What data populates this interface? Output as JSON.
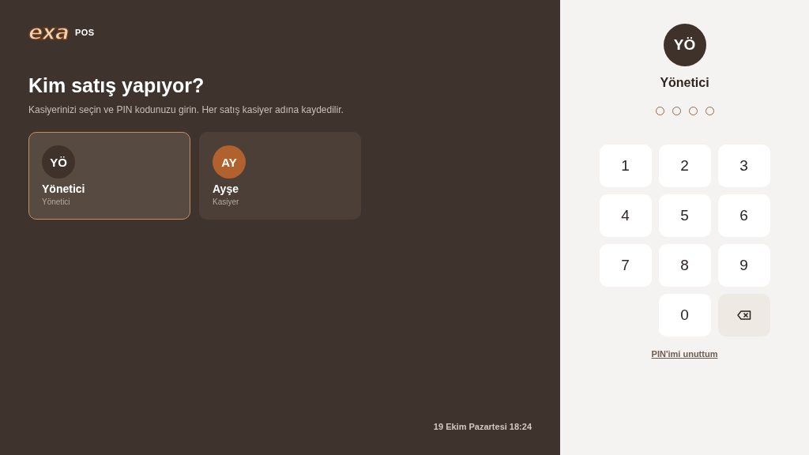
{
  "brand": {
    "logo": "exa",
    "product": "POS"
  },
  "heading": "Kim satış yapıyor?",
  "subtitle": "Kasiyerinizi seçin ve PIN kodunuzu girin. Her satış kasiyer adına kaydedilir.",
  "cashiers": [
    {
      "initials": "YÖ",
      "name": "Yönetici",
      "role": "Yönetici",
      "color": "#3e322b",
      "selected": true
    },
    {
      "initials": "AY",
      "name": "Ayşe",
      "role": "Kasiyer",
      "color": "#b0612e",
      "selected": false
    }
  ],
  "datetime": "19 Ekim Pazartesi 18:24",
  "pin_panel": {
    "initials": "YÖ",
    "name": "Yönetici",
    "pin_dots": [
      {
        "filled": false
      },
      {
        "filled": false
      },
      {
        "filled": false
      },
      {
        "filled": false
      }
    ],
    "keys": [
      {
        "kind": "digit",
        "label": "1"
      },
      {
        "kind": "digit",
        "label": "2"
      },
      {
        "kind": "digit",
        "label": "3"
      },
      {
        "kind": "digit",
        "label": "4"
      },
      {
        "kind": "digit",
        "label": "5"
      },
      {
        "kind": "digit",
        "label": "6"
      },
      {
        "kind": "digit",
        "label": "7"
      },
      {
        "kind": "digit",
        "label": "8"
      },
      {
        "kind": "digit",
        "label": "9"
      },
      {
        "kind": "blank"
      },
      {
        "kind": "digit",
        "label": "0"
      },
      {
        "kind": "backspace"
      }
    ],
    "forgot_link": "PIN'imi unuttum"
  }
}
